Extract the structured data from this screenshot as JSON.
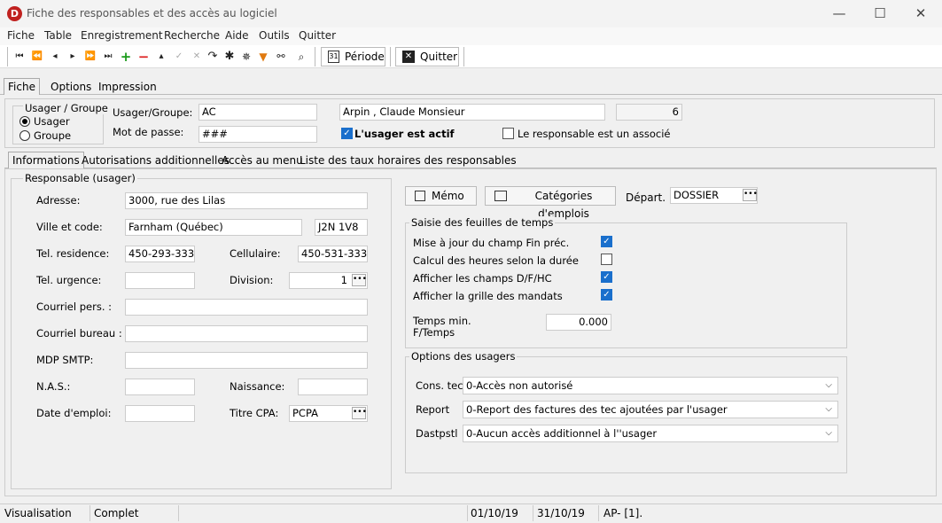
{
  "window": {
    "title": "Fiche des responsables et des accès au logiciel",
    "app_icon": "D"
  },
  "menu": [
    "Fiche",
    "Table",
    "Enregistrement",
    "Recherche",
    "Aide",
    "Outils",
    "Quitter"
  ],
  "toolbar": {
    "periode_label": "Période",
    "quitter_label": "Quitter",
    "calendar_day": "31"
  },
  "tabs_top": [
    "Fiche",
    "Options",
    "Impression"
  ],
  "user_group": {
    "legend": "Usager / Groupe",
    "usager": "Usager",
    "groupe": "Groupe",
    "selected": "Usager"
  },
  "header": {
    "usager_groupe_label": "Usager/Groupe:",
    "usager_groupe_value": "AC",
    "nom": "Arpin , Claude Monsieur",
    "numero": "6",
    "mdp_label": "Mot de passe:",
    "mdp_value": "###",
    "actif_label": "L'usager est actif",
    "actif": true,
    "associe_label": "Le responsable est un associé",
    "associe": false
  },
  "tabs_inner": [
    "Informations",
    "Autorisations additionnelles",
    "Accès au menu",
    "Liste des taux horaires des responsables"
  ],
  "info": {
    "group_title": "Responsable (usager)",
    "adresse_label": "Adresse:",
    "adresse": "3000, rue des Lilas",
    "ville_label": "Ville et code:",
    "ville": "Farnham (Québec)",
    "code": "J2N 1V8",
    "tel_res_label": "Tel. residence:",
    "tel_res": "450-293-3333",
    "cell_label": "Cellulaire:",
    "cell": "450-531-3333",
    "tel_urg_label": "Tel. urgence:",
    "tel_urg": "",
    "division_label": "Division:",
    "division": "1",
    "courriel_pers_label": "Courriel pers. :",
    "courriel_pers": "",
    "courriel_bur_label": "Courriel bureau :",
    "courriel_bur": "",
    "mdp_smtp_label": "MDP SMTP:",
    "mdp_smtp": "",
    "nas_label": "N.A.S.:",
    "nas": "",
    "naissance_label": "Naissance:",
    "naissance": "",
    "date_emploi_label": "Date d'emploi:",
    "date_emploi": "",
    "titre_cpa_label": "Titre CPA:",
    "titre_cpa": "PCPA"
  },
  "right": {
    "memo_label": "Mémo",
    "categories_label": "Catégories d'emplois",
    "depart_label": "Départ.",
    "depart": "DOSSIER",
    "saisie_title": "Saisie des feuilles de temps",
    "saisie_items": [
      {
        "label": "Mise à jour du champ Fin préc.",
        "checked": true
      },
      {
        "label": "Calcul des heures selon la durée",
        "checked": false
      },
      {
        "label": "Afficher les champs D/F/HC",
        "checked": true
      },
      {
        "label": "Afficher la grille des mandats",
        "checked": true
      }
    ],
    "temps_min_label_1": "Temps min.",
    "temps_min_label_2": "F/Temps",
    "temps_min": "0.000",
    "options_title": "Options des usagers",
    "cons_tec_label": "Cons. tec",
    "cons_tec": "0-Accès non autorisé",
    "report_label": "Report",
    "report": "0-Report des factures des tec ajoutées par l'usager",
    "dastpstl_label": "Dastpstl",
    "dastpstl": "0-Aucun accès additionnel à l''usager"
  },
  "status": {
    "mode": "Visualisation",
    "etat": "Complet",
    "date_debut": "01/10/19",
    "date_fin": "31/10/19",
    "code": "AP- [1]."
  }
}
